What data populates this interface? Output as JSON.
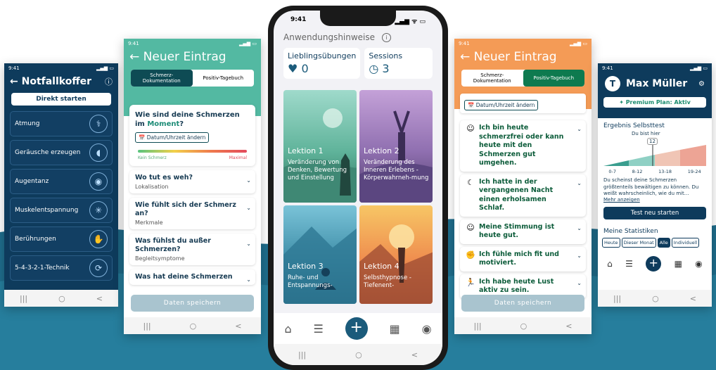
{
  "colors": {
    "navy": "#0e3b5c",
    "teal": "#53b9a2",
    "orange": "#f49b56",
    "green": "#0e7a4f",
    "wave": "#1f6d8c"
  },
  "p1": {
    "time": "9:41",
    "title": "← Notfallkoffer",
    "info": "ⓘ",
    "start": "Direkt starten",
    "items": [
      {
        "label": "Atmung",
        "icon": "lungs-icon",
        "glyph": "⚕"
      },
      {
        "label": "Geräusche erzeugen",
        "icon": "ear-icon",
        "glyph": "◖"
      },
      {
        "label": "Augentanz",
        "icon": "eye-icon",
        "glyph": "◉"
      },
      {
        "label": "Muskelentspannung",
        "icon": "body-icon",
        "glyph": "✳"
      },
      {
        "label": "Berührungen",
        "icon": "hand-icon",
        "glyph": "✋"
      },
      {
        "label": "5-4-3-2-1-Technik",
        "icon": "counter-icon",
        "glyph": "⟳"
      }
    ],
    "nav": [
      "|||",
      "○",
      "<"
    ]
  },
  "p2": {
    "time": "9:41",
    "title": "← Neuer Eintrag",
    "tab1": "Schmerz-\nDokumentation",
    "tab2": "Positiv-Tagebuch",
    "question_a": "Wie sind deine Schmerzen im ",
    "question_b": "Moment",
    "question_c": "?",
    "date_btn": "📅 Datum/Uhrzeit ändern",
    "min": "Kein Schmerz",
    "max": "Maximal",
    "cards": [
      {
        "h": "Wo tut es weh?",
        "s": "Lokalisation"
      },
      {
        "h": "Wie fühlt sich der Schmerz an?",
        "s": "Merkmale"
      },
      {
        "h": "Was fühlst du außer Schmerzen?",
        "s": "Begleitsymptome"
      },
      {
        "h": "Was hat deine Schmerzen",
        "s": ""
      }
    ],
    "save": "Daten speichern",
    "nav": [
      "|||",
      "○",
      "<"
    ]
  },
  "phone": {
    "time": "9:41",
    "signal": "▂▄▆ ᯤ ▭",
    "header": "Anwendungshinweise",
    "info": "i",
    "fav_label": "Lieblingsübungen",
    "fav_value": "0",
    "sess_label": "Sessions",
    "sess_value": "3",
    "lessons": [
      {
        "t": "Lektion 1",
        "d": "Veränderung von Denken, Bewertung und Einstellung"
      },
      {
        "t": "Lektion 2",
        "d": "Veränderung des Inneren Erlebens - Körperwahrneh-mung"
      },
      {
        "t": "Lektion 3",
        "d": "Ruhe- und Entspannungs-"
      },
      {
        "t": "Lektion 4",
        "d": "Selbsthypnose - Tiefenent-"
      }
    ],
    "nav": [
      "|||",
      "○",
      "<"
    ]
  },
  "p4": {
    "time": "9:41",
    "title": "← Neuer Eintrag",
    "tab1": "Schmerz-\nDokumentation",
    "tab2": "Positiv-Tagebuch",
    "date_btn": "📅 Datum/Uhrzeit ändern",
    "cards": [
      {
        "e": "☺",
        "icon": "thinking-icon",
        "x": "Ich bin heute schmerzfrei oder kann heute mit den Schmerzen gut umgehen."
      },
      {
        "e": "☾",
        "icon": "sleep-icon",
        "x": "Ich hatte in der vergangenen Nacht einen erholsamen Schlaf."
      },
      {
        "e": "☺",
        "icon": "smile-icon",
        "x": "Meine Stimmung ist heute gut."
      },
      {
        "e": "✊",
        "icon": "strength-icon",
        "x": "Ich fühle mich fit und motiviert."
      },
      {
        "e": "🏃",
        "icon": "run-icon",
        "x": "Ich habe heute Lust aktiv zu sein."
      }
    ],
    "save": "Daten speichern",
    "nav": [
      "|||",
      "○",
      "<"
    ]
  },
  "p5": {
    "time": "9:41",
    "avatar": "T",
    "name": "Max Müller",
    "premium": "✦ Premium Plan: Aktiv",
    "test_title": "Ergebnis Selbsttest",
    "here": "Du bist hier",
    "score": "12",
    "ranges": [
      "0-7",
      "8-12",
      "13-18",
      "19-24"
    ],
    "text": "Du scheinst deine Schmerzen größtenteils bewältigen zu können. Du weißt wahrscheinlich, wie du mit...",
    "more": "Mehr anzeigen",
    "restart": "Test neu starten",
    "stats": "Meine Statistiken",
    "periods": [
      "Heute",
      "Dieser Monat",
      "Alle",
      "Individuell"
    ],
    "nav": [
      "|||",
      "○",
      "<"
    ]
  }
}
